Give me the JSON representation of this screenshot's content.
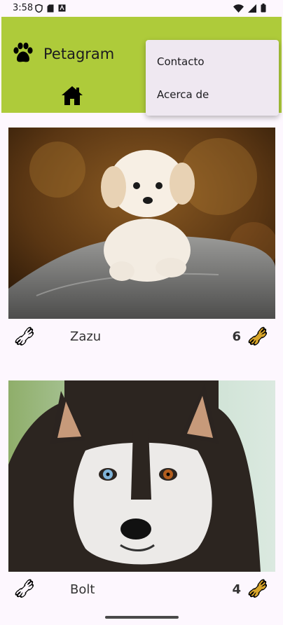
{
  "status_bar": {
    "time": "3:58",
    "left_icons": [
      "shield-icon",
      "sd-card-icon",
      "app-notification-icon"
    ],
    "right_icons": [
      "wifi-icon",
      "signal-icon",
      "battery-icon"
    ]
  },
  "app_bar": {
    "title": "Petagram",
    "logo_icon": "paw-icon",
    "home_icon": "home-icon",
    "color": "#aecb3a"
  },
  "overflow_menu": {
    "items": [
      {
        "label": "Contacto"
      },
      {
        "label": "Acerca de"
      }
    ]
  },
  "pets": [
    {
      "name": "Zazu",
      "likes": "6",
      "photo": "white-fluffy-puppy-on-rock",
      "rate_icon": "bone-outline-icon",
      "likes_icon": "bone-gold-icon"
    },
    {
      "name": "Bolt",
      "likes": "4",
      "photo": "husky-with-heterochromia",
      "rate_icon": "bone-outline-icon",
      "likes_icon": "bone-gold-icon"
    }
  ]
}
